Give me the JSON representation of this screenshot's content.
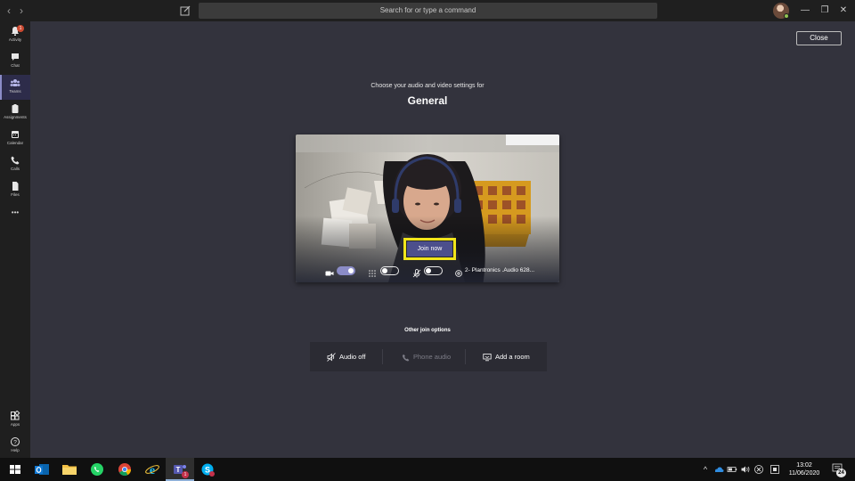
{
  "titlebar": {
    "search_placeholder": "Search for or type a command",
    "back": "‹",
    "forward": "›",
    "minimize": "—",
    "maximize": "❐",
    "close": "✕"
  },
  "rail": {
    "activity": {
      "label": "Activity",
      "badge": "1"
    },
    "chat": {
      "label": "Chat"
    },
    "teams": {
      "label": "Teams"
    },
    "assignments": {
      "label": "Assignments"
    },
    "calendar": {
      "label": "Calendar"
    },
    "calls": {
      "label": "Calls"
    },
    "files": {
      "label": "Files"
    },
    "more": {
      "label": "•••"
    },
    "apps": {
      "label": "Apps"
    },
    "help": {
      "label": "Help"
    }
  },
  "close_label": "Close",
  "heading": {
    "subtitle": "Choose your audio and video settings for",
    "title": "General"
  },
  "preview": {
    "join_label": "Join now",
    "camera_on": true,
    "blur_on": false,
    "mic_on": false,
    "device": "2- Plantronics .Audio 628..."
  },
  "other": {
    "title": "Other join options",
    "audio_off": "Audio off",
    "phone_audio": "Phone audio",
    "add_room": "Add a room"
  },
  "taskbar": {
    "time": "13:02",
    "date": "11/06/2020",
    "notifications": "24",
    "teams_badge": "1"
  },
  "colors": {
    "accent": "#8b8cc7",
    "join_button": "#4c4f8c",
    "highlight": "#f1e51a",
    "background": "#33333d"
  }
}
